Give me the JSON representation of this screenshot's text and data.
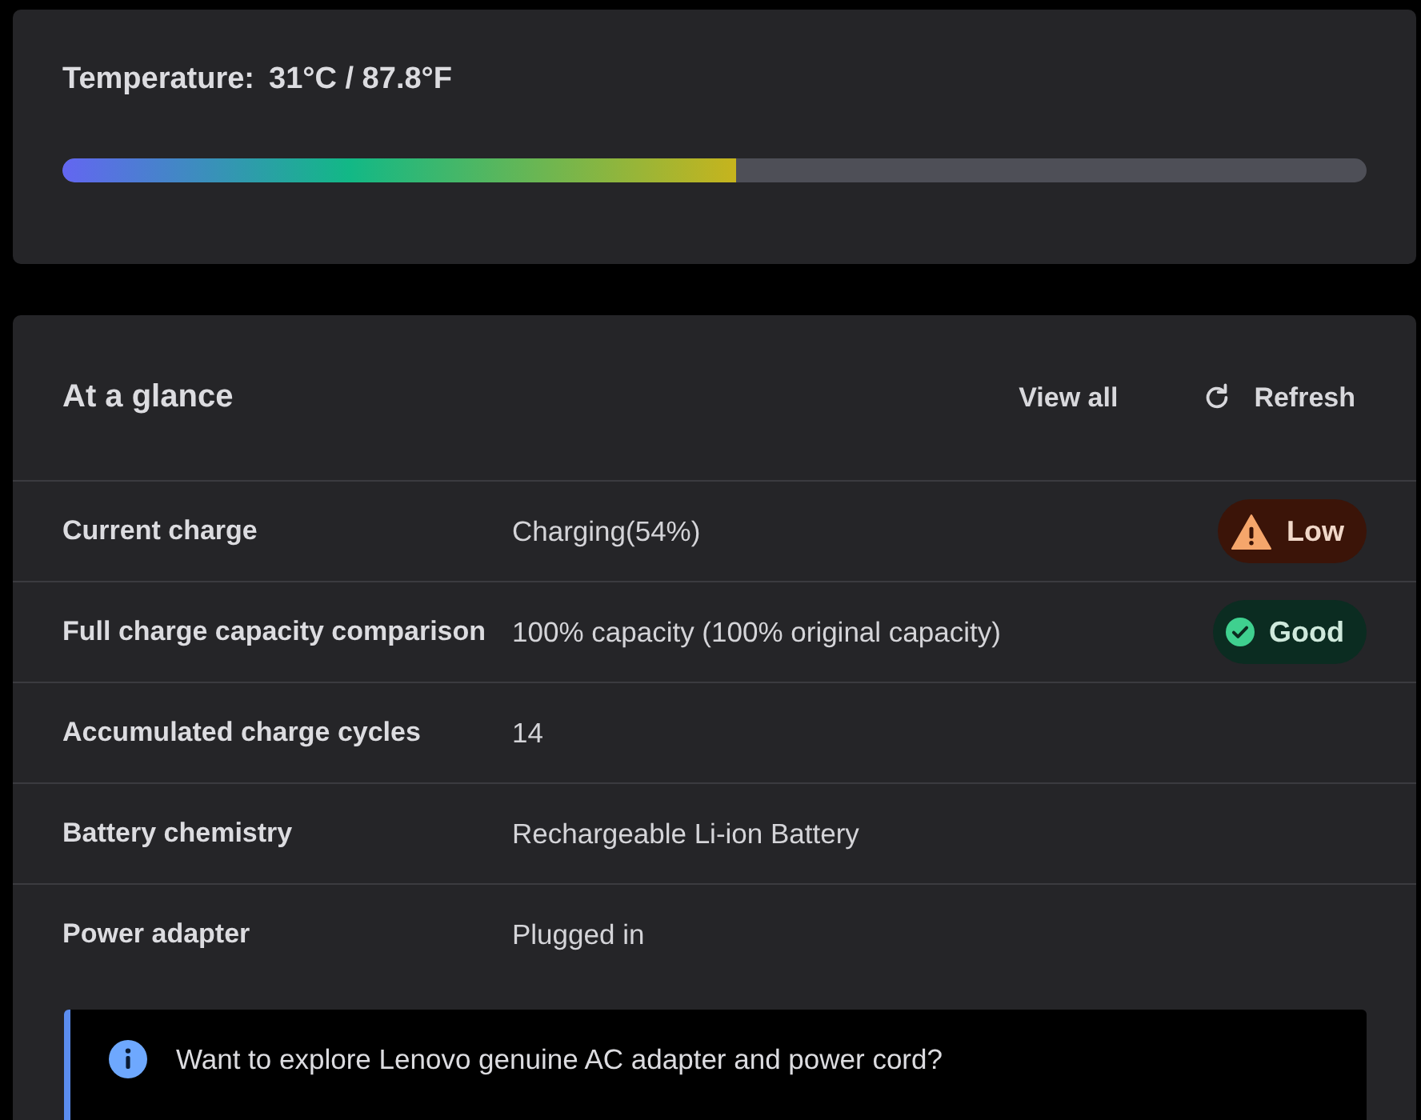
{
  "temperature": {
    "label": "Temperature:",
    "value": "31°C / 87.8°F",
    "level": 0.517
  },
  "glance": {
    "title": "At a glance",
    "actions": [
      {
        "kind": "link",
        "label": "View all"
      },
      {
        "kind": "refresh",
        "label": "Refresh"
      }
    ],
    "rows": [
      {
        "label": "Current charge",
        "value": "Charging(54%)",
        "badge": {
          "kind": "warning",
          "text": "Low"
        }
      },
      {
        "label": "Full charge capacity comparison",
        "value": "100% capacity (100% original capacity)",
        "badge": {
          "kind": "good",
          "text": "Good"
        }
      },
      {
        "label": "Accumulated charge cycles",
        "value": "14"
      },
      {
        "label": "Battery chemistry",
        "value": "Rechargeable Li-ion Battery"
      },
      {
        "label": "Power adapter",
        "value": "Plugged in"
      }
    ],
    "info": {
      "text": "Want to explore Lenovo genuine AC adapter and power cord?"
    }
  }
}
